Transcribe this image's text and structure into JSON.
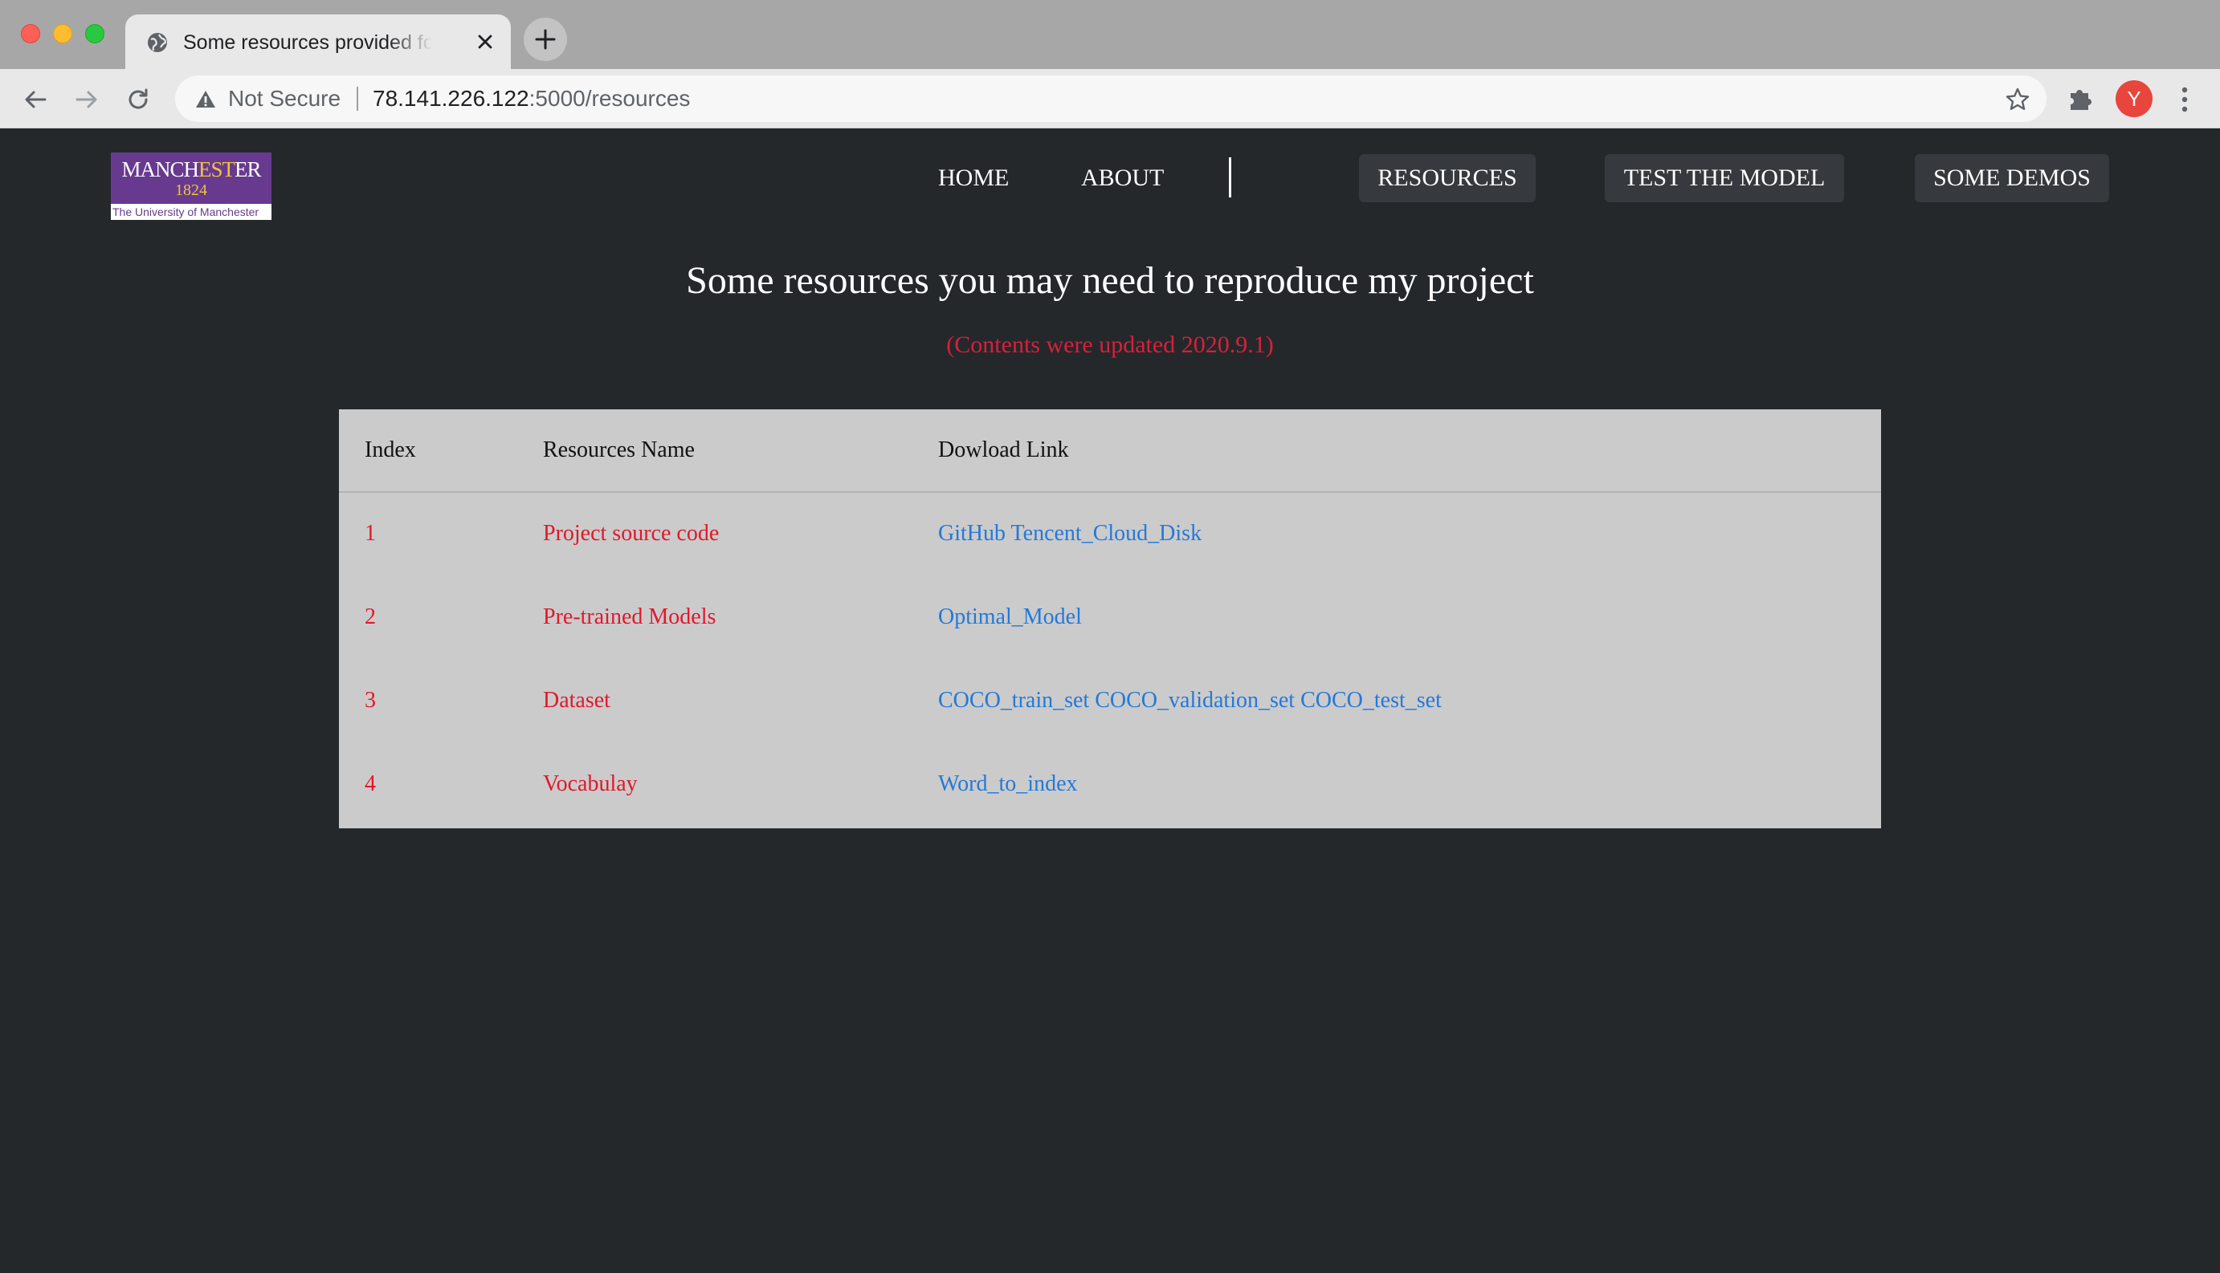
{
  "browser": {
    "tab_title": "Some resources provided for this project",
    "not_secure_label": "Not Secure",
    "url_host": "78.141.226.122",
    "url_rest": ":5000/resources",
    "avatar_letter": "Y"
  },
  "logo": {
    "name_part1": "MANCH",
    "name_part2": "EST",
    "name_part3": "ER",
    "year": "1824",
    "subtitle": "The University of Manchester"
  },
  "nav": {
    "home": "HOME",
    "about": "ABOUT",
    "resources": "RESOURCES",
    "test_model": "TEST THE MODEL",
    "demos": "SOME DEMOS"
  },
  "main": {
    "heading": "Some resources you may need to reproduce my project",
    "updated_note": "(Contents were updated 2020.9.1)"
  },
  "table": {
    "headers": [
      "Index",
      "Resources Name",
      "Dowload Link"
    ],
    "rows": [
      {
        "index": "1",
        "name": "Project source code",
        "links": [
          "GitHub",
          "Tencent_Cloud_Disk"
        ]
      },
      {
        "index": "2",
        "name": "Pre-trained Models",
        "links": [
          "Optimal_Model"
        ]
      },
      {
        "index": "3",
        "name": "Dataset",
        "links": [
          "COCO_train_set",
          "COCO_validation_set",
          "COCO_test_set"
        ]
      },
      {
        "index": "4",
        "name": "Vocabulay",
        "links": [
          "Word_to_index"
        ]
      }
    ]
  },
  "colors": {
    "page_bg": "#24282b",
    "accent_red": "#e0182c",
    "link_blue": "#2479d8",
    "table_bg": "#cbcbcb"
  }
}
